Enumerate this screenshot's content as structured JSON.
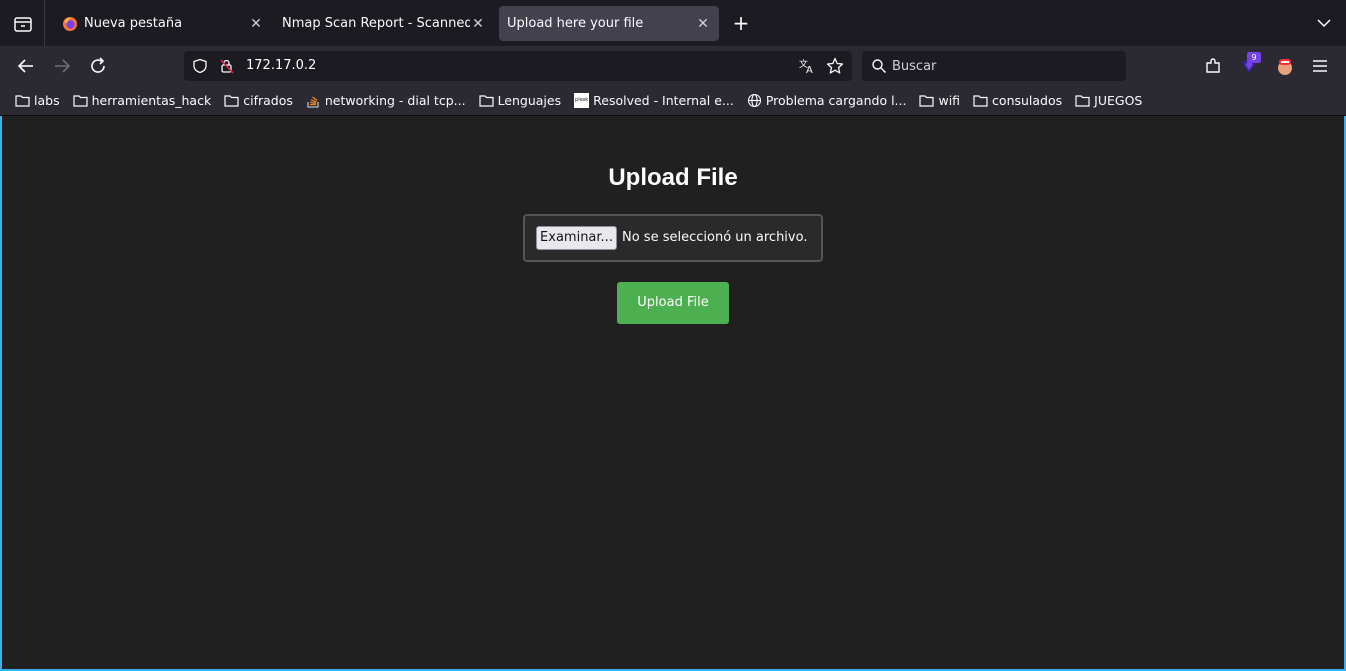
{
  "browser": {
    "tabs": [
      {
        "title": "Nueva pestaña",
        "active": false
      },
      {
        "title": "Nmap Scan Report - Scanned at S",
        "active": false
      },
      {
        "title": "Upload here your file",
        "active": true
      }
    ],
    "url": "172.17.0.2",
    "search_placeholder": "Buscar",
    "extension_badge_count": "9"
  },
  "bookmarks": [
    {
      "label": "labs",
      "icon": "folder-icon"
    },
    {
      "label": "herramientas_hack",
      "icon": "folder-icon"
    },
    {
      "label": "cifrados",
      "icon": "folder-icon"
    },
    {
      "label": "networking - dial tcp...",
      "icon": "stackoverflow-icon"
    },
    {
      "label": "Lenguajes",
      "icon": "folder-icon"
    },
    {
      "label": "Resolved - Internal e...",
      "icon": "plesk-icon"
    },
    {
      "label": "Problema cargando l...",
      "icon": "globe-icon"
    },
    {
      "label": "wifi",
      "icon": "folder-icon"
    },
    {
      "label": "consulados",
      "icon": "folder-icon"
    },
    {
      "label": "JUEGOS",
      "icon": "folder-icon"
    }
  ],
  "page": {
    "heading": "Upload File",
    "browse_label": "Examinar...",
    "file_status": "No se seleccionó un archivo.",
    "submit_label": "Upload File",
    "plesk_icon_text": "plesk"
  },
  "colors": {
    "page_background": "#202020",
    "submit_button": "#4caf50",
    "active_tab": "#42414d",
    "window_border": "#3daee9"
  }
}
